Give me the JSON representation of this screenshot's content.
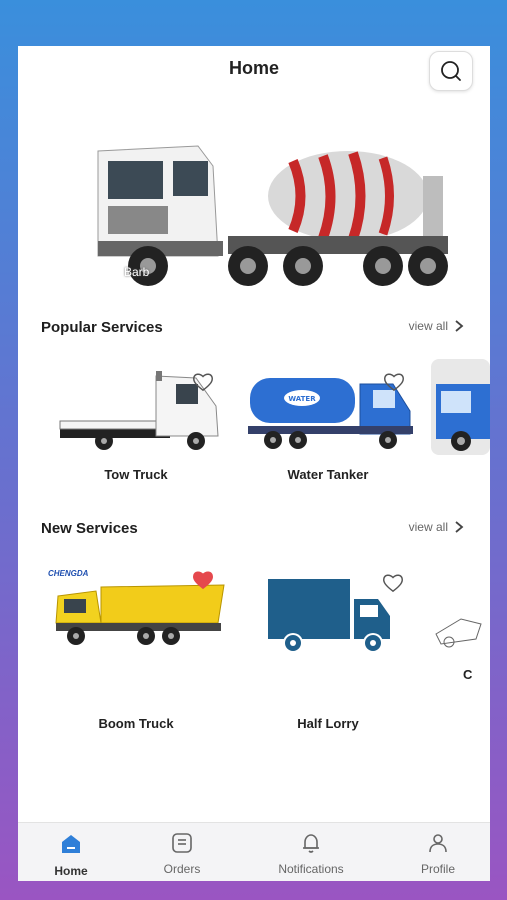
{
  "header": {
    "title": "Home",
    "search_icon": "search-icon"
  },
  "banner": {
    "caption": "Barb",
    "image": "concrete-mixer-truck"
  },
  "popular": {
    "title": "Popular Services",
    "view_all": "view all",
    "items": [
      {
        "label": "Tow Truck",
        "image": "tow-truck",
        "favorited": false
      },
      {
        "label": "Water Tanker",
        "image": "water-tanker",
        "favorited": false
      },
      {
        "label": "",
        "image": "truck-partial",
        "favorited": false
      }
    ]
  },
  "new": {
    "title": "New Services",
    "view_all": "view all",
    "items": [
      {
        "label": "Boom Truck",
        "image": "dump-truck",
        "brand": "CHENGDA",
        "favorited": true
      },
      {
        "label": "Half Lorry",
        "image": "lorry",
        "favorited": false
      },
      {
        "label": "C",
        "image": "partial",
        "favorited": false
      }
    ]
  },
  "nav": {
    "items": [
      {
        "label": "Home",
        "icon": "home-icon",
        "active": true
      },
      {
        "label": "Orders",
        "icon": "orders-icon",
        "active": false
      },
      {
        "label": "Notifications",
        "icon": "bell-icon",
        "active": false
      },
      {
        "label": "Profile",
        "icon": "user-icon",
        "active": false
      }
    ]
  },
  "colors": {
    "accent": "#2f7fd8",
    "heart_active": "#e5484d",
    "lorry": "#1f5f8b"
  }
}
